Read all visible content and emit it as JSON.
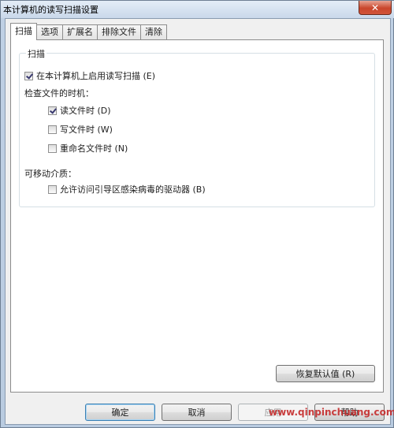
{
  "window": {
    "title": "本计算机的读写扫描设置",
    "close_label": "✕"
  },
  "tabs": [
    {
      "label": "扫描",
      "active": true
    },
    {
      "label": "选项",
      "active": false
    },
    {
      "label": "扩展名",
      "active": false
    },
    {
      "label": "排除文件",
      "active": false
    },
    {
      "label": "清除",
      "active": false
    }
  ],
  "scan": {
    "group_title": "扫描",
    "enable_label": "在本计算机上启用读写扫描 (E)",
    "enable_checked": true,
    "timing_heading": "检查文件的时机：",
    "read_label": "读文件时 (D)",
    "read_checked": true,
    "write_label": "写文件时 (W)",
    "write_checked": false,
    "rename_label": "重命名文件时 (N)",
    "rename_checked": false,
    "removable_heading": "可移动介质：",
    "boot_label": "允许访问引导区感染病毒的驱动器 (B)",
    "boot_checked": false
  },
  "buttons": {
    "restore_defaults": "恢复默认值 (R)",
    "ok": "确定",
    "cancel": "取消",
    "apply": "应用",
    "help": "帮助"
  },
  "watermark": "www.qinpinchuang.com"
}
